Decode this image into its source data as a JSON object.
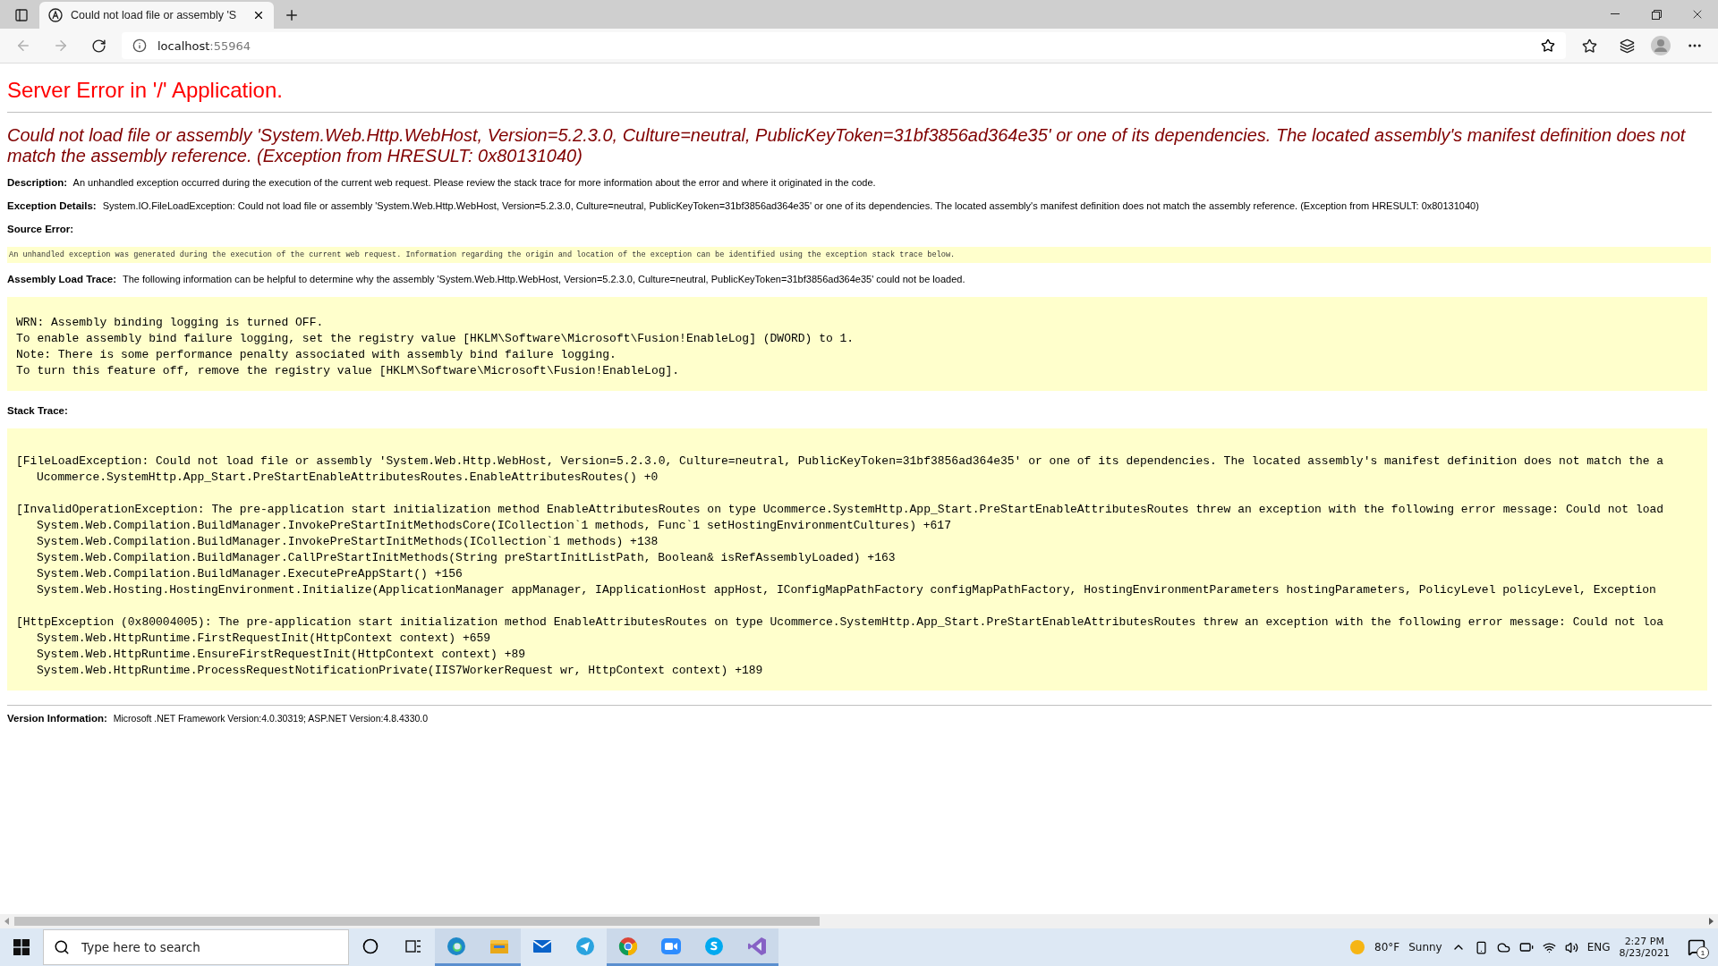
{
  "browser": {
    "tab": {
      "title": "Could not load file or assembly 'S"
    },
    "address": {
      "host": "localhost",
      "port": ":55964"
    }
  },
  "page": {
    "title": "Server Error in '/' Application.",
    "error_heading": "Could not load file or assembly 'System.Web.Http.WebHost, Version=5.2.3.0, Culture=neutral, PublicKeyToken=31bf3856ad364e35' or one of its dependencies. The located assembly's manifest definition does not match the assembly reference. (Exception from HRESULT: 0x80131040)",
    "sections": [
      {
        "kind": "text",
        "label": "Description:",
        "text": "An unhandled exception occurred during the execution of the current web request. Please review the stack trace for more information about the error and where it originated in the code."
      },
      {
        "kind": "text",
        "label": "Exception Details:",
        "text": "System.IO.FileLoadException: Could not load file or assembly 'System.Web.Http.WebHost, Version=5.2.3.0, Culture=neutral, PublicKeyToken=31bf3856ad364e35' or one of its dependencies. The located assembly's manifest definition does not match the assembly reference. (Exception from HRESULT: 0x80131040)"
      },
      {
        "kind": "heading",
        "label": "Source Error:"
      },
      {
        "kind": "note",
        "text": "An unhandled exception was generated during the execution of the current web request. Information regarding the origin and location of the exception can be identified using the exception stack trace below."
      },
      {
        "kind": "text",
        "label": "Assembly Load Trace:",
        "text": "The following information can be helpful to determine why the assembly 'System.Web.Http.WebHost, Version=5.2.3.0, Culture=neutral, PublicKeyToken=31bf3856ad364e35' could not be loaded."
      },
      {
        "kind": "code",
        "blocks": [
          {
            "head": "WRN: Assembly binding logging is turned OFF."
          },
          {
            "head": "To enable assembly bind failure logging, set the registry value [HKLM\\Software\\Microsoft\\Fusion!EnableLog] (DWORD) to 1."
          },
          {
            "head": "Note: There is some performance penalty associated with assembly bind failure logging."
          },
          {
            "head": "To turn this feature off, remove the registry value [HKLM\\Software\\Microsoft\\Fusion!EnableLog]."
          }
        ]
      },
      {
        "kind": "heading",
        "label": "Stack Trace:"
      },
      {
        "kind": "code",
        "blocks": [
          {
            "head": "[FileLoadException: Could not load file or assembly 'System.Web.Http.WebHost, Version=5.2.3.0, Culture=neutral, PublicKeyToken=31bf3856ad364e35' or one of its dependencies. The located assembly's manifest definition does not match the a",
            "frames": [
              "Ucommerce.SystemHttp.App_Start.PreStartEnableAttributesRoutes.EnableAttributesRoutes() +0"
            ]
          },
          {
            "head": "[InvalidOperationException: The pre-application start initialization method EnableAttributesRoutes on type Ucommerce.SystemHttp.App_Start.PreStartEnableAttributesRoutes threw an exception with the following error message: Could not load",
            "frames": [
              "System.Web.Compilation.BuildManager.InvokePreStartInitMethodsCore(ICollection`1 methods, Func`1 setHostingEnvironmentCultures) +617",
              "System.Web.Compilation.BuildManager.InvokePreStartInitMethods(ICollection`1 methods) +138",
              "System.Web.Compilation.BuildManager.CallPreStartInitMethods(String preStartInitListPath, Boolean& isRefAssemblyLoaded) +163",
              "System.Web.Compilation.BuildManager.ExecutePreAppStart() +156",
              "System.Web.Hosting.HostingEnvironment.Initialize(ApplicationManager appManager, IApplicationHost appHost, IConfigMapPathFactory configMapPathFactory, HostingEnvironmentParameters hostingParameters, PolicyLevel policyLevel, Exception"
            ]
          },
          {
            "head": "[HttpException (0x80004005): The pre-application start initialization method EnableAttributesRoutes on type Ucommerce.SystemHttp.App_Start.PreStartEnableAttributesRoutes threw an exception with the following error message: Could not loa",
            "frames": [
              "System.Web.HttpRuntime.FirstRequestInit(HttpContext context) +659",
              "System.Web.HttpRuntime.EnsureFirstRequestInit(HttpContext context) +89",
              "System.Web.HttpRuntime.ProcessRequestNotificationPrivate(IIS7WorkerRequest wr, HttpContext context) +189"
            ]
          }
        ]
      }
    ],
    "version": {
      "label": "Version Information:",
      "text": "Microsoft .NET Framework Version:4.0.30319; ASP.NET Version:4.8.4330.0"
    }
  },
  "taskbar": {
    "search": {
      "placeholder": "Type here to search"
    },
    "apps": [
      {
        "kind": "edge",
        "running": true
      },
      {
        "kind": "explorer",
        "running": true
      },
      {
        "kind": "mail",
        "running": false
      },
      {
        "kind": "telegram",
        "running": false
      },
      {
        "kind": "chrome",
        "running": true
      },
      {
        "kind": "zoom",
        "running": true
      },
      {
        "kind": "skype",
        "running": true
      },
      {
        "kind": "vs",
        "running": true
      }
    ],
    "weather": {
      "temperature": "80°F",
      "condition": "Sunny"
    },
    "language": "ENG",
    "time": "2:27 PM",
    "date": "8/23/2021",
    "notifications": "1"
  }
}
